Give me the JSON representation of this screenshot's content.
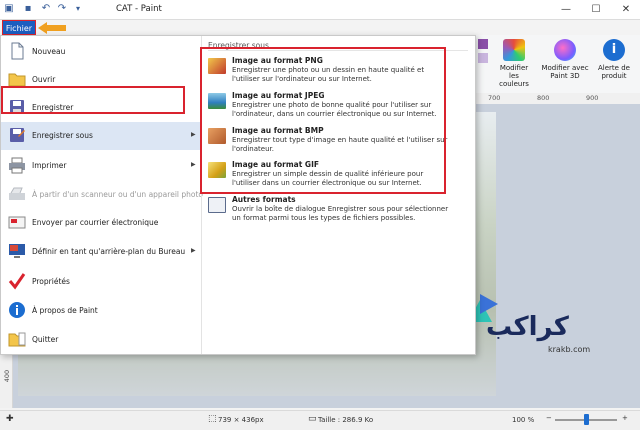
{
  "window": {
    "title": "CAT - Paint",
    "minimize": "—",
    "maximize": "☐",
    "close": "✕"
  },
  "file_tab": {
    "label": "Fichier"
  },
  "ribbon": {
    "items": [
      {
        "label": "Modifier les couleurs",
        "icon": "palette-icon"
      },
      {
        "label": "Modifier avec Paint 3D",
        "icon": "paint3d-icon"
      },
      {
        "label": "Alerte de produit",
        "icon": "info-icon"
      }
    ]
  },
  "ruler": {
    "marks": [
      "700",
      "800",
      "900"
    ],
    "left_mark": "400"
  },
  "file_menu": {
    "items": [
      {
        "label": "Nouveau",
        "icon": "new-file-icon",
        "disabled": false,
        "submenu": false
      },
      {
        "label": "Ouvrir",
        "icon": "open-folder-icon",
        "disabled": false,
        "submenu": false
      },
      {
        "label": "Enregistrer",
        "icon": "save-icon",
        "disabled": false,
        "submenu": false
      },
      {
        "label": "Enregistrer sous",
        "icon": "save-as-icon",
        "disabled": false,
        "submenu": true
      },
      {
        "label": "Imprimer",
        "icon": "print-icon",
        "disabled": false,
        "submenu": true
      },
      {
        "label": "À partir d'un scanneur ou d'un appareil photo",
        "icon": "scanner-icon",
        "disabled": true,
        "submenu": false
      },
      {
        "label": "Envoyer par courrier électronique",
        "icon": "email-icon",
        "disabled": false,
        "submenu": false
      },
      {
        "label": "Définir en tant qu'arrière-plan du Bureau",
        "icon": "desktop-background-icon",
        "disabled": false,
        "submenu": true
      },
      {
        "label": "Propriétés",
        "icon": "properties-check-icon",
        "disabled": false,
        "submenu": false
      },
      {
        "label": "À propos de Paint",
        "icon": "about-info-icon",
        "disabled": false,
        "submenu": false
      },
      {
        "label": "Quitter",
        "icon": "exit-icon",
        "disabled": false,
        "submenu": false
      }
    ],
    "save_as_panel": {
      "title": "Enregistrer sous",
      "formats": [
        {
          "title": "Image au format PNG",
          "desc": "Enregistrer une photo ou un dessin en haute qualité et l'utiliser sur l'ordinateur ou sur Internet.",
          "icon": "png-image-icon",
          "color": "#c0392b"
        },
        {
          "title": "Image au format JPEG",
          "desc": "Enregistrer une photo de bonne qualité pour l'utiliser sur l'ordinateur, dans un courrier électronique ou sur Internet.",
          "icon": "jpeg-image-icon",
          "color": "#2f7fbf"
        },
        {
          "title": "Image au format BMP",
          "desc": "Enregistrer tout type d'image en haute qualité et l'utiliser sur l'ordinateur.",
          "icon": "bmp-image-icon",
          "color": "#b05a2c"
        },
        {
          "title": "Image au format GIF",
          "desc": "Enregistrer un simple dessin de qualité inférieure pour l'utiliser dans un courrier électronique ou sur Internet.",
          "icon": "gif-image-icon",
          "color": "#d4a017"
        },
        {
          "title": "Autres formats",
          "desc": "Ouvrir la boîte de dialogue Enregistrer sous pour sélectionner un format parmi tous les types de fichiers possibles.",
          "icon": "other-formats-icon",
          "color": "#5b6b8c"
        }
      ]
    }
  },
  "status": {
    "dimensions": "739 × 436px",
    "size": "Taille : 286.9 Ko",
    "zoom": "100 %",
    "zoom_level": 0.5
  },
  "watermark": {
    "text": "كراكب",
    "url": "krakb.com"
  },
  "colors": {
    "accent": "#1c5ec0",
    "highlight": "#d9232e"
  }
}
